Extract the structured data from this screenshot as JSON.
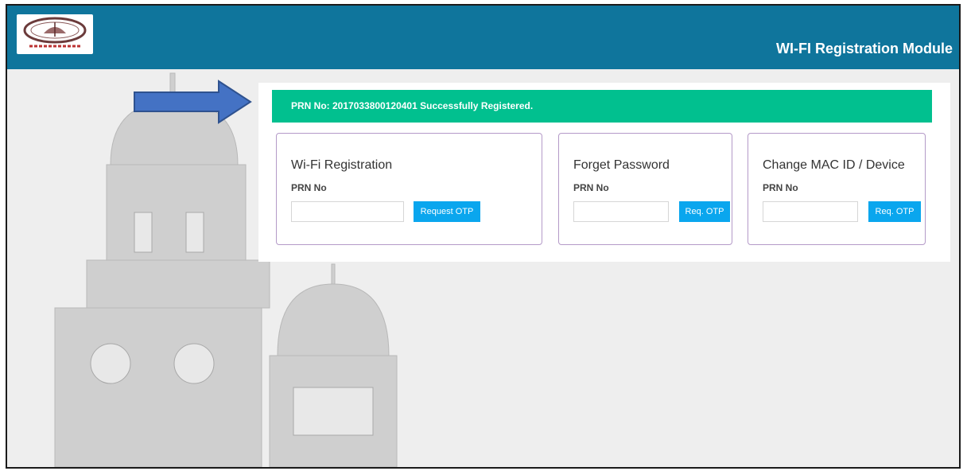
{
  "header": {
    "title": "WI-FI Registration Module",
    "logo_icon": "university-seal-logo",
    "logo_text": "सत्यं शिवं सुन्दरम्",
    "brand_color": "#0f759c"
  },
  "alert": {
    "message": "PRN No: 2017033800120401 Successfully Registered.",
    "color": "#01c08f"
  },
  "cards": [
    {
      "title": "Wi-Fi Registration",
      "label": "PRN No",
      "value": "",
      "button": "Request OTP"
    },
    {
      "title": "Forget Password",
      "label": "PRN No",
      "value": "",
      "button": "Req. OTP"
    },
    {
      "title": "Change MAC ID / Device",
      "label": "PRN No",
      "value": "",
      "button": "Req. OTP"
    }
  ],
  "button_color": "#0aa6ee"
}
